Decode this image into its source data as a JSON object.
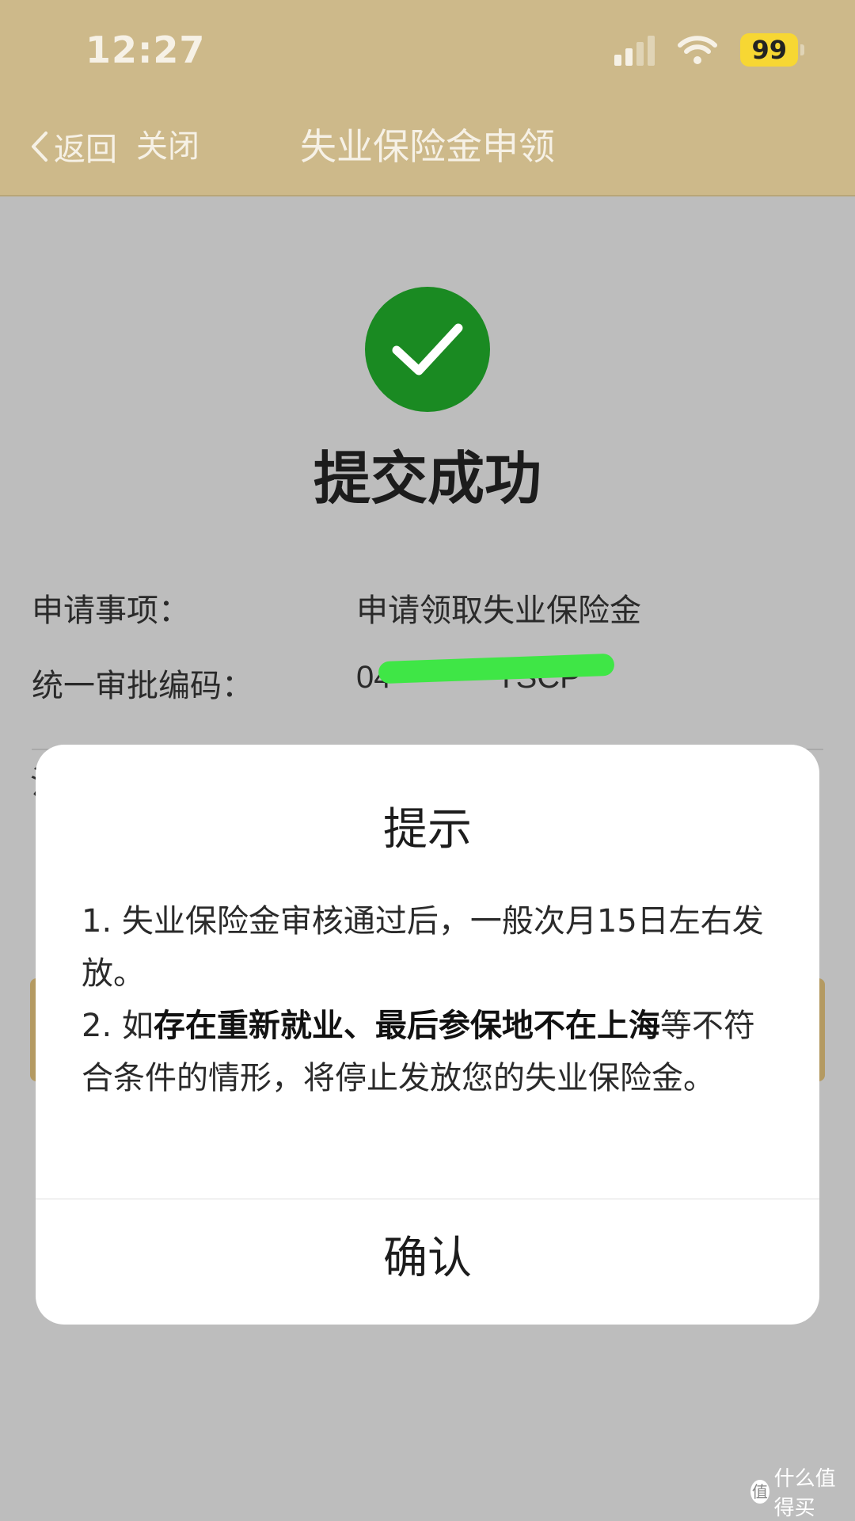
{
  "status_bar": {
    "time": "12:27",
    "battery": "99",
    "icons": [
      "signal-icon",
      "wifi-icon",
      "battery-icon"
    ]
  },
  "nav": {
    "back_label": "返回",
    "close_label": "关闭",
    "title": "失业保险金申领"
  },
  "result": {
    "title": "提交成功",
    "icon": "check-circle-icon",
    "icon_color": "#1a8a22"
  },
  "info": {
    "item_label": "申请事项：",
    "item_value": "申请领取失业保险金",
    "code_label": "统一审批编码：",
    "code_value": "04            TSCP"
  },
  "dialog": {
    "title": "提示",
    "line1": "1. 失业保险金审核通过后，一般次月15日左右发放。",
    "line2_prefix": "2. 如",
    "line2_bold": "存在重新就业、最后参保地不在上海",
    "line2_suffix": "等不符合条件的情形，将停止发放您的失业保险金。",
    "confirm_label": "确认"
  },
  "watermark": {
    "text": "什么值得买",
    "logo": "值"
  },
  "colors": {
    "header_bg": "#cdb98a",
    "overlay_bg": "#bdbdbd",
    "success": "#1a8a22",
    "battery": "#f7d733"
  }
}
